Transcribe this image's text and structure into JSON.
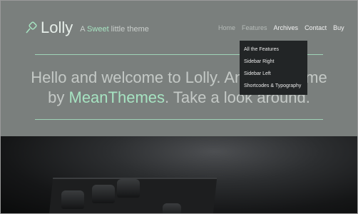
{
  "colors": {
    "hero_bg": "#7a7f7d",
    "accent": "#a6e3c1",
    "dropdown_bg": "#222526"
  },
  "logo": {
    "name": "Lolly",
    "icon": "lollipop-icon",
    "tagline_prefix": "A ",
    "tagline_accent": "Sweet",
    "tagline_suffix": " little theme"
  },
  "nav": {
    "items": [
      "Home",
      "Features",
      "Archives",
      "Contact",
      "Buy"
    ]
  },
  "dropdown": {
    "items": [
      "All the Features",
      "Sidebar Right",
      "Sidebar Left",
      "Shortcodes & Typography"
    ]
  },
  "hero": {
    "line1": "Hello and welcome to Lolly. Another theme by",
    "link": "MeanThemes",
    "line2_suffix": ". Take a look around."
  }
}
